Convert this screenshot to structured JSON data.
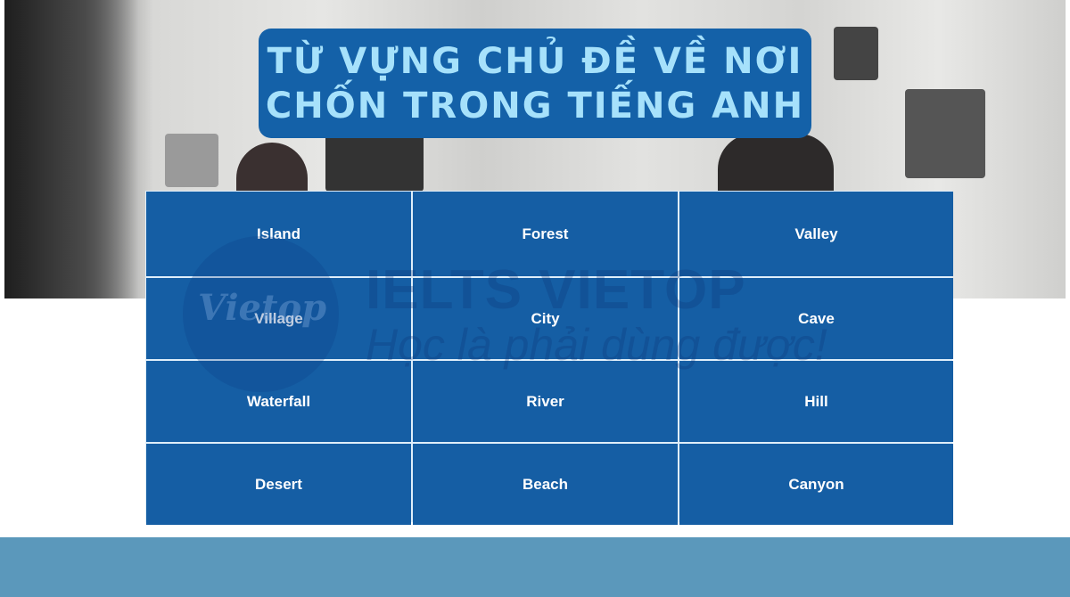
{
  "title": {
    "line1": "TỪ VỰNG CHỦ ĐỀ VỀ NƠI",
    "line2": "CHỐN TRONG TIẾNG ANH"
  },
  "vocabulary": [
    [
      "Island",
      "Forest",
      "Valley"
    ],
    [
      "Village",
      "City",
      "Cave"
    ],
    [
      "Waterfall",
      "River",
      "Hill"
    ],
    [
      "Desert",
      "Beach",
      "Canyon"
    ]
  ],
  "watermark": {
    "logo": "Vietop",
    "brand": "IELTS VIETOP",
    "slogan": "Học là phải dùng được!"
  },
  "colors": {
    "title_bg": "#1461a8",
    "title_text": "#a6e1fb",
    "cell_bg": "#155ea4",
    "cell_text": "#ffffff",
    "footer_band": "#5b98bb"
  }
}
